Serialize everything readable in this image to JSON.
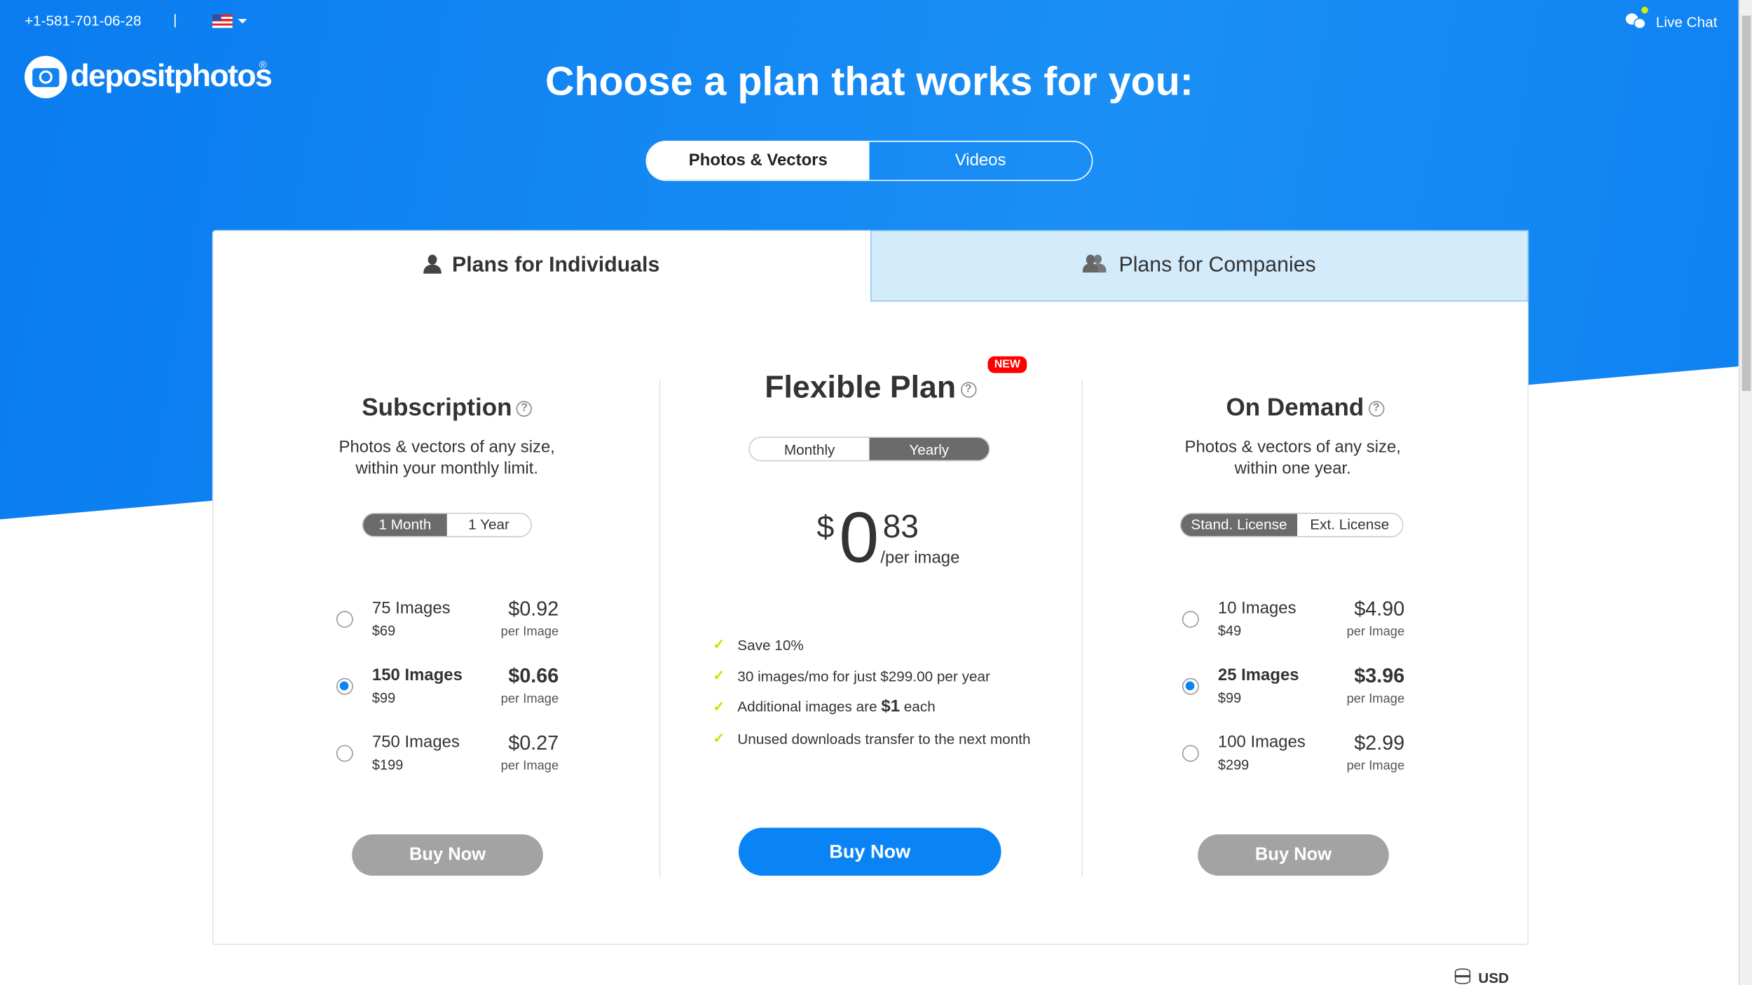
{
  "topbar": {
    "phone": "+1-581-701-06-28",
    "separator": "|",
    "language_icon": "us-flag-icon",
    "live_chat": "Live Chat"
  },
  "logo": {
    "text": "depositphotos",
    "registered": "®"
  },
  "title": "Choose a plan that works for you:",
  "media_tabs": [
    {
      "label": "Photos & Vectors",
      "active": true
    },
    {
      "label": "Videos",
      "active": false
    }
  ],
  "plan_tabs": [
    {
      "label": "Plans for Individuals",
      "icon": "user-icon",
      "active": true
    },
    {
      "label": "Plans for Companies",
      "icon": "users-icon",
      "active": false
    }
  ],
  "subscription": {
    "title": "Subscription",
    "desc1": "Photos & vectors of any size,",
    "desc2": "within your monthly limit.",
    "periods": [
      "1 Month",
      "1 Year"
    ],
    "active_period": "1 Month",
    "options": [
      {
        "name": "75 Images",
        "total": "$69",
        "price": "$0.92",
        "per": "per Image",
        "selected": false
      },
      {
        "name": "150 Images",
        "total": "$99",
        "price": "$0.66",
        "per": "per Image",
        "selected": true
      },
      {
        "name": "750 Images",
        "total": "$199",
        "price": "$0.27",
        "per": "per Image",
        "selected": false
      }
    ],
    "button": "Buy Now"
  },
  "flexible": {
    "title": "Flexible Plan",
    "badge": "NEW",
    "periods": [
      "Monthly",
      "Yearly"
    ],
    "active_period": "Yearly",
    "currency": "$",
    "price_int": "0",
    "price_dec": "83",
    "price_unit": "/per image",
    "features": [
      "Save 10%",
      "30 images/mo for just $299.00 per year",
      "Additional images are ",
      "Unused downloads transfer to the next month"
    ],
    "feature3_bold": "$1",
    "feature3_tail": " each",
    "button": "Buy Now",
    "accent": "#0a84f5",
    "check_color": "#c8e600"
  },
  "ondemand": {
    "title": "On Demand",
    "desc1": "Photos & vectors of any size,",
    "desc2": "within one year.",
    "licenses": [
      "Stand. License",
      "Ext. License"
    ],
    "active_license": "Stand. License",
    "options": [
      {
        "name": "10 Images",
        "total": "$49",
        "price": "$4.90",
        "per": "per Image",
        "selected": false
      },
      {
        "name": "25 Images",
        "total": "$99",
        "price": "$3.96",
        "per": "per Image",
        "selected": true
      },
      {
        "name": "100 Images",
        "total": "$299",
        "price": "$2.99",
        "per": "per Image",
        "selected": false
      }
    ],
    "button": "Buy Now"
  },
  "currency": {
    "label": "USD",
    "icon": "database-icon"
  }
}
